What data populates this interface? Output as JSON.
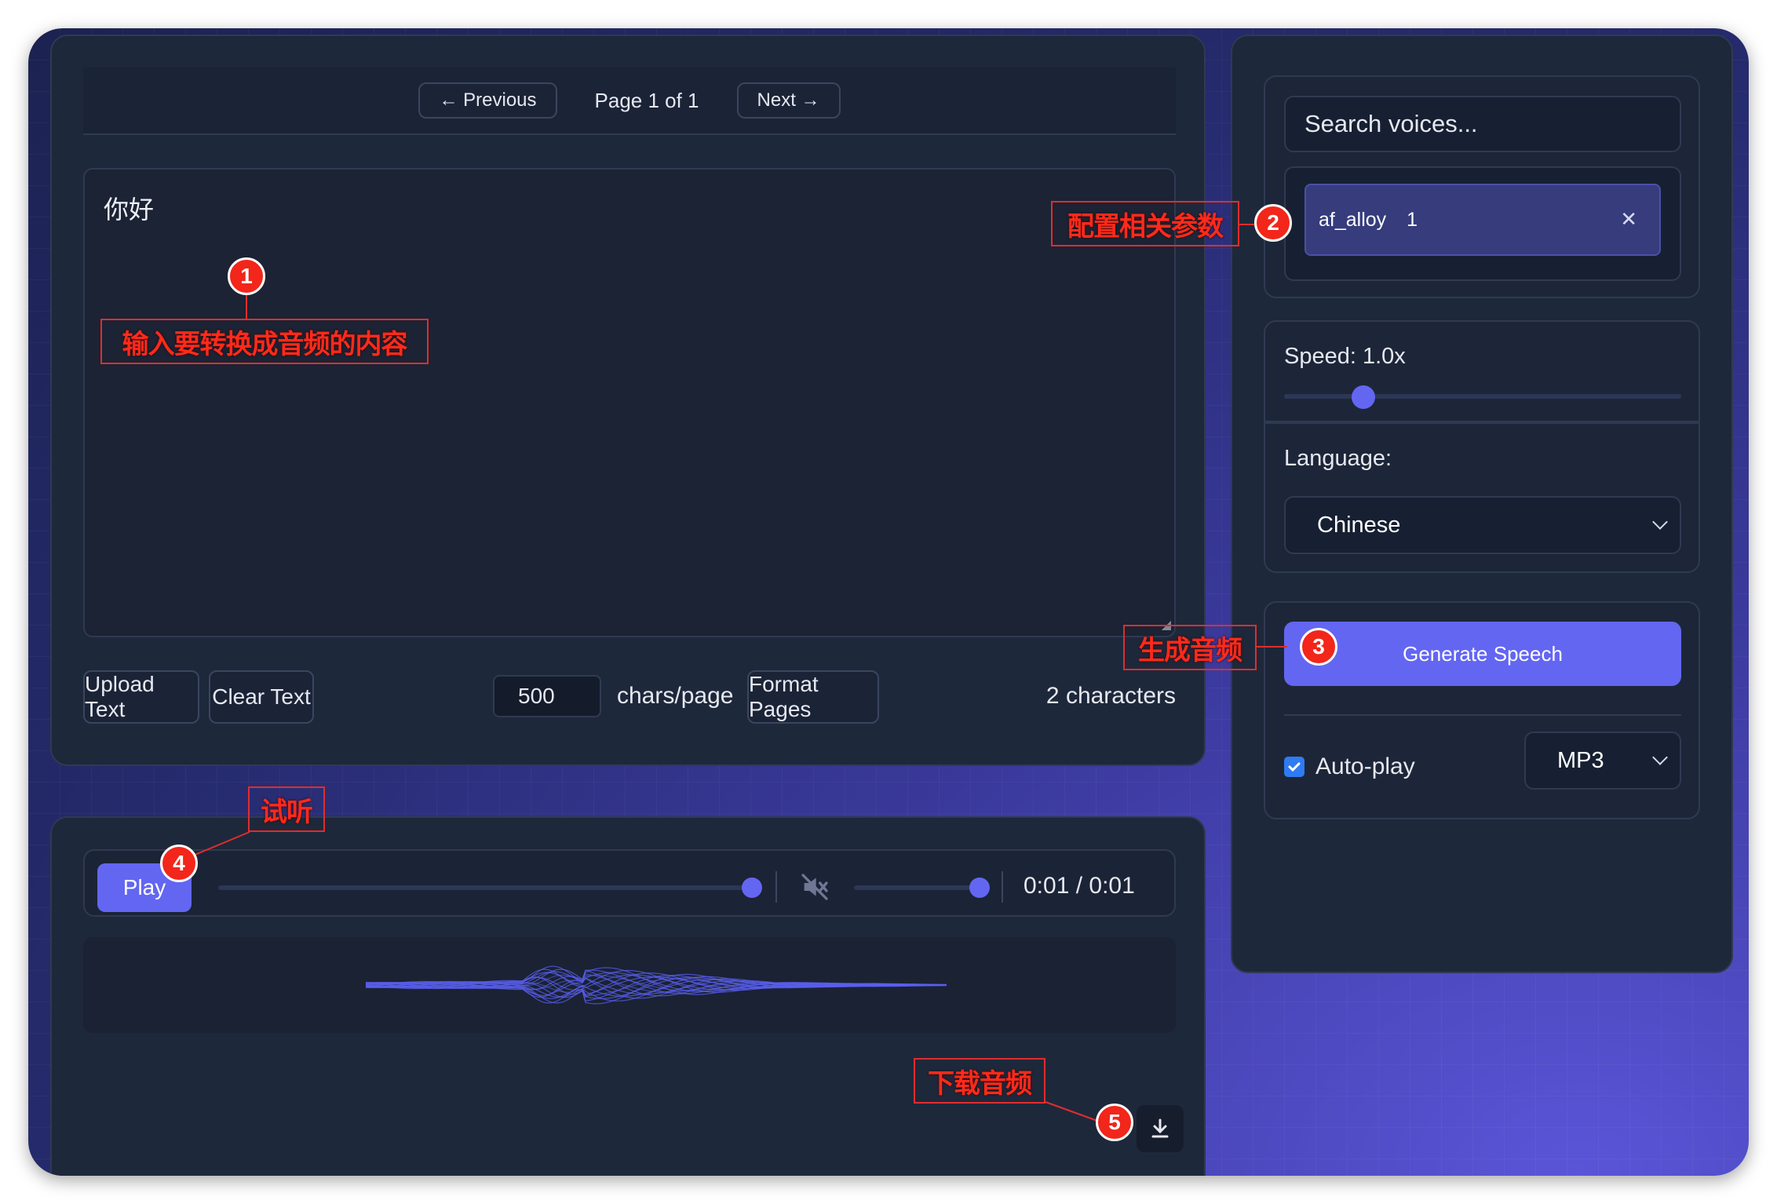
{
  "pager": {
    "previous_label": "← Previous",
    "page_info": "Page 1 of 1",
    "next_label": "Next →"
  },
  "editor": {
    "text": "你好"
  },
  "toolbar": {
    "upload_label": "Upload Text",
    "clear_label": "Clear Text",
    "chars_per_page_value": "500",
    "chars_per_page_label": "chars/page",
    "format_label": "Format Pages",
    "char_count": "2 characters"
  },
  "player": {
    "play_label": "Play",
    "progress": 1.0,
    "volume": 1.0,
    "muted_icon": "volume-mute-icon",
    "time": "0:01 / 0:01",
    "download_icon": "download-icon"
  },
  "voices": {
    "search_placeholder": "Search voices...",
    "selected": [
      {
        "name": "af_alloy",
        "weight": "1"
      }
    ]
  },
  "speed": {
    "label": "Speed: 1.0x",
    "value": 1.0,
    "min": 0.25,
    "max": 4.0
  },
  "language": {
    "label": "Language:",
    "selected": "Chinese"
  },
  "generate": {
    "label": "Generate Speech",
    "autoplay_label": "Auto-play",
    "autoplay_checked": true,
    "format": "MP3"
  },
  "annotations": [
    {
      "number": "1",
      "text": "输入要转换成音频的内容"
    },
    {
      "number": "2",
      "text": "配置相关参数"
    },
    {
      "number": "3",
      "text": "生成音频"
    },
    {
      "number": "4",
      "text": "试听"
    },
    {
      "number": "5",
      "text": "下载音频"
    }
  ],
  "colors": {
    "accent": "#6366f1",
    "panel": "#1e283b",
    "annotation": "#ff2a1a"
  }
}
